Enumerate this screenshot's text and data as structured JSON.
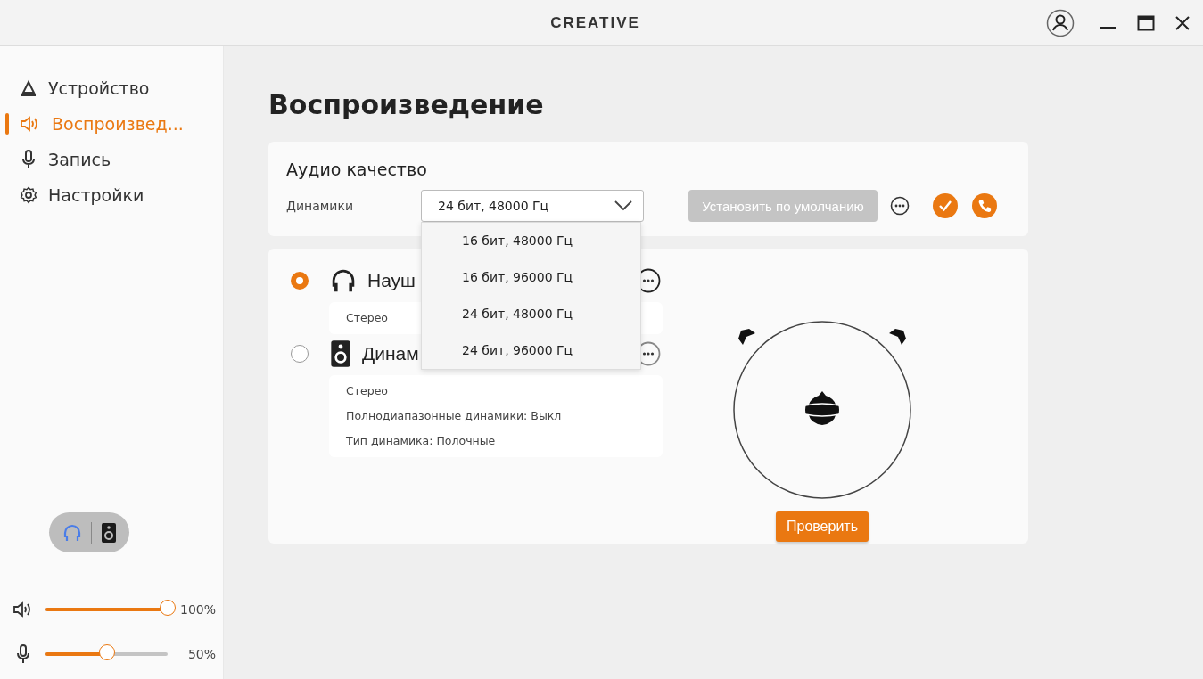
{
  "logo": "CREATIVE",
  "nav": [
    {
      "label": "Устройство",
      "selected": false
    },
    {
      "label": "Воспроизвед...",
      "selected": true
    },
    {
      "label": "Запись",
      "selected": false
    },
    {
      "label": "Настройки",
      "selected": false
    }
  ],
  "device_switch": [
    {
      "kind": "headphones",
      "selected": true
    },
    {
      "kind": "speaker",
      "selected": false
    }
  ],
  "sliders": [
    {
      "kind": "volume",
      "level": 1,
      "reading": "100%"
    },
    {
      "kind": "mic",
      "level": 0.5,
      "reading": "50%"
    }
  ],
  "page_title": "Воспроизведение",
  "audio_quality": {
    "title": "Аудио качество",
    "label": "Динамики",
    "value": "24 бит, 48000 Гц",
    "default_button": {
      "label": "Установить по умолчанию",
      "disabled": true
    },
    "options": [
      "16 бит, 48000 Гц",
      "16 бит, 96000 Гц",
      "24 бит, 48000 Гц",
      "24 бит, 96000 Гц"
    ]
  },
  "outputs": [
    {
      "kind": "headphones",
      "name": "Науш",
      "selected": true,
      "details": [
        "Стерео"
      ]
    },
    {
      "kind": "speaker",
      "name": "Динам",
      "selected": false,
      "details": [
        "Стерео",
        "Полнодиапазонные динамики:  Выкл",
        "Тип динамика:  Полочные"
      ]
    }
  ],
  "test_button": "Проверить"
}
